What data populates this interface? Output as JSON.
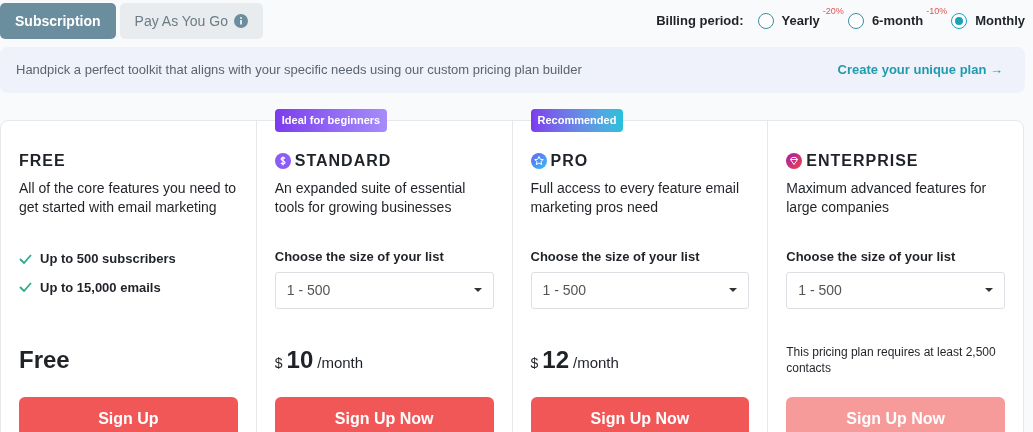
{
  "tabs": [
    {
      "label": "Subscription",
      "selected": true
    },
    {
      "label": "Pay As You Go",
      "selected": false
    }
  ],
  "billing": {
    "label": "Billing period:",
    "options": [
      {
        "label": "Yearly",
        "discount": "-20%",
        "selected": false
      },
      {
        "label": "6-month",
        "discount": "-10%",
        "selected": false
      },
      {
        "label": "Monthly",
        "selected": true
      }
    ]
  },
  "banner": {
    "text": "Handpick a perfect toolkit that aligns with your specific needs using our custom pricing plan builder",
    "link": "Create your unique plan →"
  },
  "plans": [
    {
      "name": "FREE",
      "description": "All of the core features you need to get started with email marketing",
      "kind": "features",
      "features": [
        "Up to 500 subscribers",
        "Up to 15,000 emails"
      ],
      "price": {
        "kind": "free",
        "amount": "Free"
      },
      "button": {
        "label": "Sign Up",
        "disabled": false
      }
    },
    {
      "name": "STANDARD",
      "badge": {
        "label": "Ideal for beginners",
        "kind": "purple"
      },
      "description": "An expanded suite of essential tools for growing businesses",
      "kind": "select",
      "select_label": "Choose the size of your list",
      "select_value": "1 - 500",
      "price": {
        "kind": "paid",
        "currency": "$",
        "amount": "10",
        "period": "/month"
      },
      "button": {
        "label": "Sign Up Now",
        "disabled": false
      }
    },
    {
      "name": "PRO",
      "badge": {
        "label": "Recommended",
        "kind": "gradient"
      },
      "description": "Full access to every feature email marketing pros need",
      "kind": "select",
      "select_label": "Choose the size of your list",
      "select_value": "1 - 500",
      "price": {
        "kind": "paid",
        "currency": "$",
        "amount": "12",
        "period": "/month"
      },
      "button": {
        "label": "Sign Up Now",
        "disabled": false
      }
    },
    {
      "name": "ENTERPRISE",
      "description": "Maximum advanced features for large companies",
      "kind": "select",
      "select_label": "Choose the size of your list",
      "select_value": "1 - 500",
      "price": {
        "kind": "note",
        "text": "This pricing plan requires at least 2,500 contacts"
      },
      "button": {
        "label": "Sign Up Now",
        "disabled": true
      }
    }
  ]
}
